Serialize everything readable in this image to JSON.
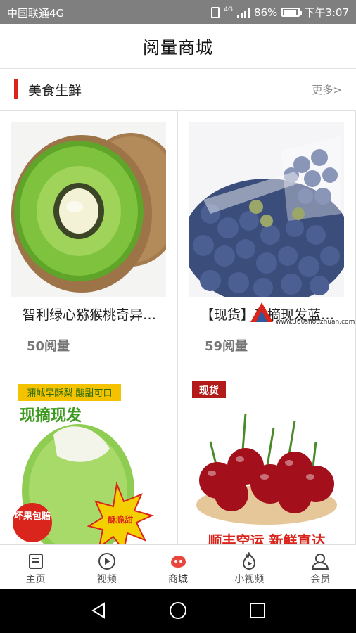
{
  "status_bar": {
    "carrier": "中国联通4G",
    "battery": "86%",
    "time": "下午3:07",
    "net_label": "4G",
    "battery_level": 0.86
  },
  "header": {
    "title": "阅量商城"
  },
  "section": {
    "title": "美食生鲜",
    "more": "更多>"
  },
  "products": [
    {
      "name": "智利绿心猕猴桃奇异…",
      "reads": "50阅量"
    },
    {
      "name": "【现货】现摘现发蓝…",
      "reads": "59阅量"
    },
    {
      "badge1": "蒲城早酥梨 酸甜可口",
      "badge2": "现摘现发",
      "seal": "坏果包赔",
      "burst": "酥脆甜"
    },
    {
      "tag": "现货",
      "slogan": "顺丰空运 新鲜直达"
    }
  ],
  "watermark": {
    "url": "www.360shouzhuan.com"
  },
  "tabs": [
    {
      "label": "主页",
      "icon": "home-icon"
    },
    {
      "label": "视频",
      "icon": "play-icon"
    },
    {
      "label": "商城",
      "icon": "mall-icon"
    },
    {
      "label": "小视频",
      "icon": "flame-play-icon"
    },
    {
      "label": "会员",
      "icon": "member-icon"
    }
  ],
  "colors": {
    "accent_red": "#d9251c",
    "status_bar_bg": "#7f7f7f"
  }
}
